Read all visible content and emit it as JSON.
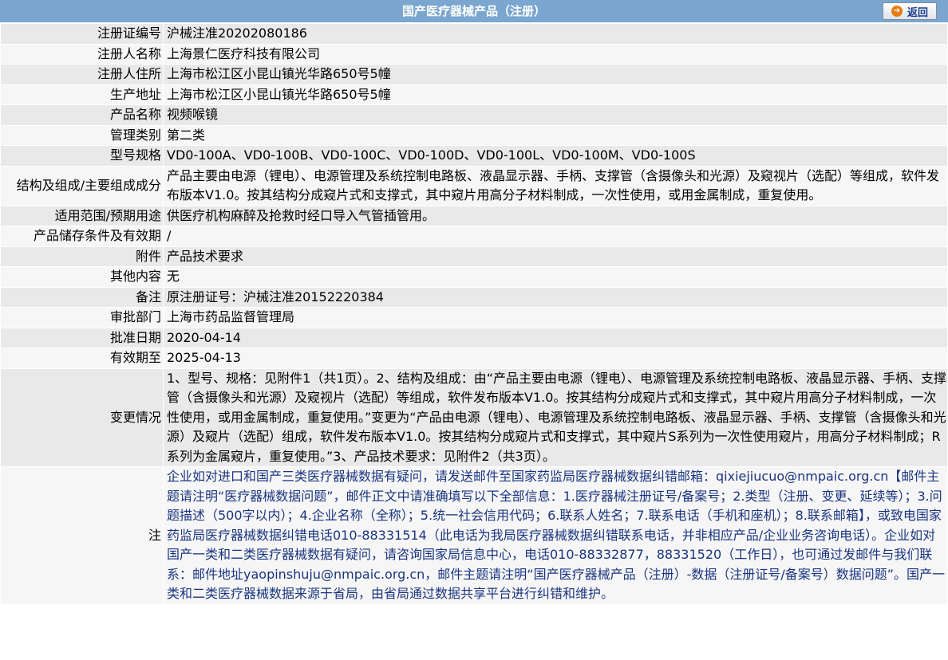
{
  "header": {
    "title": "国产医疗器械产品（注册）",
    "back_label": "返回"
  },
  "rows": [
    {
      "label": "注册证编号",
      "value": "沪械注准20202080186"
    },
    {
      "label": "注册人名称",
      "value": "上海景仁医疗科技有限公司"
    },
    {
      "label": "注册人住所",
      "value": "上海市松江区小昆山镇光华路650号5幢"
    },
    {
      "label": "生产地址",
      "value": "上海市松江区小昆山镇光华路650号5幢"
    },
    {
      "label": "产品名称",
      "value": "视频喉镜"
    },
    {
      "label": "管理类别",
      "value": "第二类"
    },
    {
      "label": "型号规格",
      "value": "VD0-100A、VD0-100B、VD0-100C、VD0-100D、VD0-100L、VD0-100M、VD0-100S"
    },
    {
      "label": "结构及组成/主要组成成分",
      "value": "产品主要由电源（锂电）、电源管理及系统控制电路板、液晶显示器、手柄、支撑管（含摄像头和光源）及窥视片（选配）等组成，软件发布版本V1.0。按其结构分成窥片式和支撑式，其中窥片用高分子材料制成，一次性使用，或用金属制成，重复使用。"
    },
    {
      "label": "适用范围/预期用途",
      "value": "供医疗机构麻醉及抢救时经口导入气管插管用。"
    },
    {
      "label": "产品储存条件及有效期",
      "value": "/"
    },
    {
      "label": "附件",
      "value": "产品技术要求"
    },
    {
      "label": "其他内容",
      "value": "无"
    },
    {
      "label": "备注",
      "value": "原注册证号：沪械注准20152220384"
    },
    {
      "label": "审批部门",
      "value": "上海市药品监督管理局"
    },
    {
      "label": "批准日期",
      "value": "2020-04-14"
    },
    {
      "label": "有效期至",
      "value": "2025-04-13"
    },
    {
      "label": "变更情况",
      "value": "1、型号、规格：见附件1（共1页）。2、结构及组成：由“产品主要由电源（锂电）、电源管理及系统控制电路板、液晶显示器、手柄、支撑管（含摄像头和光源）及窥视片（选配）等组成，软件发布版本V1.0。按其结构分成窥片式和支撑式，其中窥片用高分子材料制成，一次性使用，或用金属制成，重复使用。”变更为“产品由电源（锂电）、电源管理及系统控制电路板、液晶显示器、手柄、支撑管（含摄像头和光源）及窥片（选配）组成，软件发布版本V1.0。按其结构分成窥片式和支撑式，其中窥片S系列为一次性使用窥片，用高分子材料制成；R系列为金属窥片，重复使用。”3、产品技术要求：见附件2（共3页）。"
    },
    {
      "label": "注",
      "value": "企业如对进口和国产三类医疗器械数据有疑问，请发送邮件至国家药监局医疗器械数据纠错邮箱：qixiejiucuo@nmpaic.org.cn【邮件主题请注明“医疗器械数据问题”，邮件正文中请准确填写以下全部信息：1.医疗器械注册证号/备案号；2.类型（注册、变更、延续等）；3.问题描述（500字以内）；4.企业名称（全称）；5.统一社会信用代码；6.联系人姓名；7.联系电话（手机和座机）；8.联系邮箱】，或致电国家药监局医疗器械数据纠错电话010-88331514（此电话为我局医疗器械数据纠错联系电话，并非相应产品/企业业务咨询电话）。企业如对国产一类和二类医疗器械数据有疑问，请咨询国家局信息中心，电话010-88332877，88331520（工作日），也可通过发邮件与我们联系：邮件地址yaopinshuju@nmpaic.org.cn，邮件主题请注明“国产医疗器械产品（注册）-数据（注册证号/备案号）数据问题”。国产一类和二类医疗器械数据来源于省局，由省局通过数据共享平台进行纠错和维护。"
    }
  ]
}
